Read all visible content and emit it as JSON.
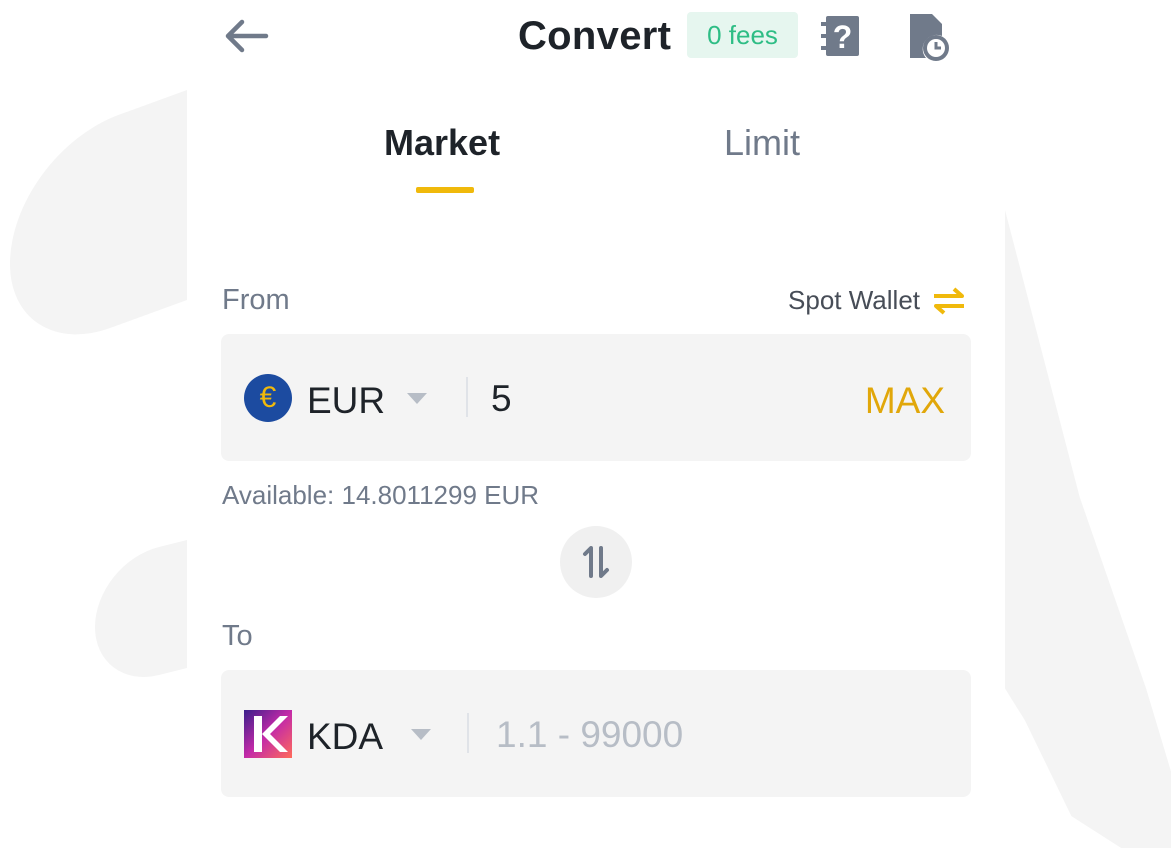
{
  "header": {
    "title": "Convert",
    "fee_badge": "0 fees",
    "icons": [
      "back-arrow-icon",
      "help-icon",
      "history-icon"
    ]
  },
  "tabs": [
    {
      "label": "Market",
      "active": true
    },
    {
      "label": "Limit",
      "active": false
    }
  ],
  "from": {
    "label": "From",
    "wallet_label": "Spot Wallet",
    "coin": "EUR",
    "coin_symbol": "€",
    "amount": "5",
    "max_label": "MAX",
    "available": "Available: 14.8011299 EUR"
  },
  "to": {
    "label": "To",
    "coin": "KDA",
    "coin_symbol": "K",
    "amount_placeholder": "1.1 - 99000"
  },
  "colors": {
    "accent": "#f0b90b",
    "fee_green": "#2ebd85",
    "field_bg": "#f4f4f4",
    "text_secondary": "#707a8a"
  }
}
